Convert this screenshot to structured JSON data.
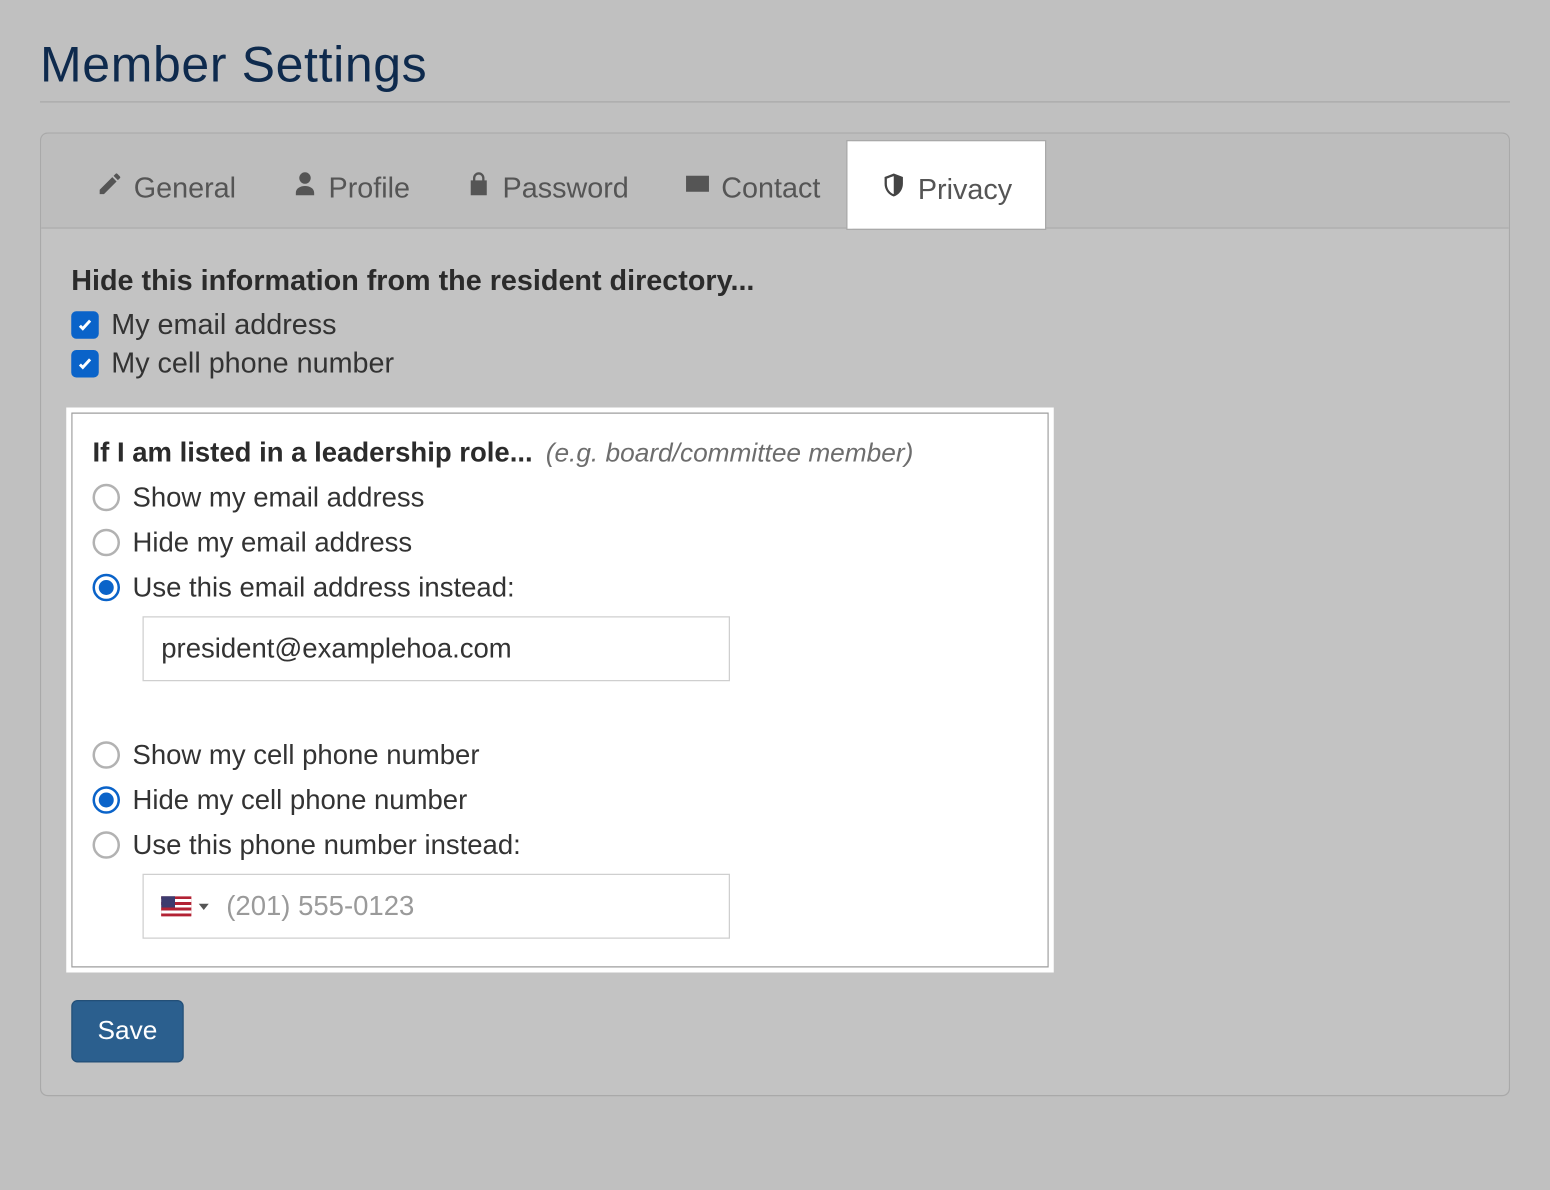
{
  "page_title": "Member Settings",
  "tabs": {
    "general": "General",
    "profile": "Profile",
    "password": "Password",
    "contact": "Contact",
    "privacy": "Privacy"
  },
  "hide_section": {
    "heading": "Hide this information from the resident directory...",
    "email_label": "My email address",
    "cell_label": "My cell phone number"
  },
  "leadership": {
    "heading": "If I am listed in a leadership role...",
    "note": "(e.g. board/committee member)",
    "email_show": "Show my email address",
    "email_hide": "Hide my email address",
    "email_alt": "Use this email address instead:",
    "email_value": "president@examplehoa.com",
    "cell_show": "Show my cell phone number",
    "cell_hide": "Hide my cell phone number",
    "cell_alt": "Use this phone number instead:",
    "phone_placeholder": "(201) 555-0123"
  },
  "save_label": "Save"
}
